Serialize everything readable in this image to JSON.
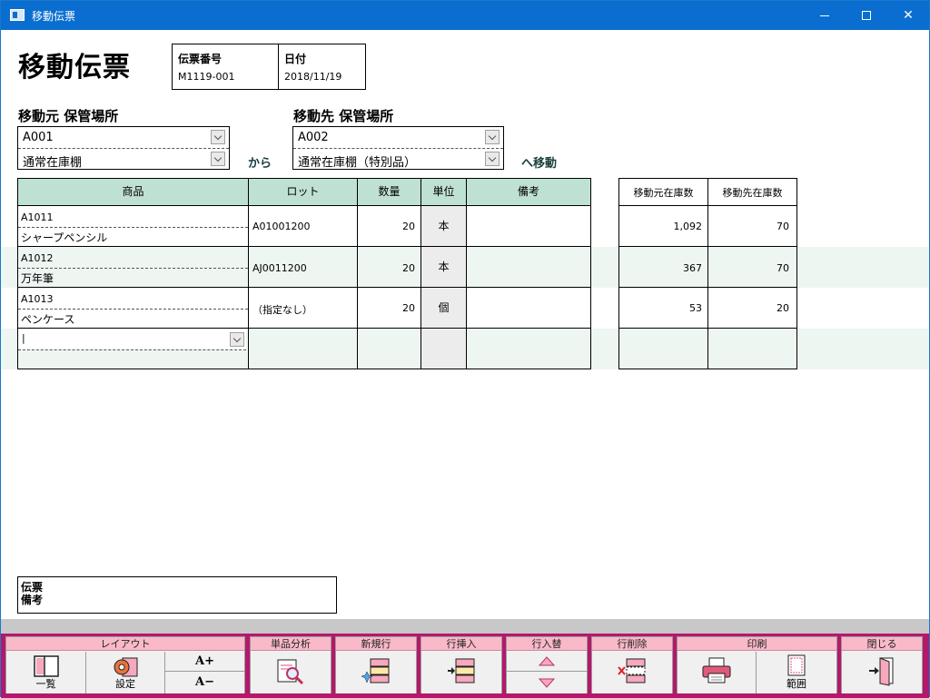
{
  "window": {
    "title": "移動伝票"
  },
  "page_title": "移動伝票",
  "header": {
    "slip_number_label": "伝票番号",
    "slip_number": "M1119-001",
    "date_label": "日付",
    "date": "2018/11/19"
  },
  "source": {
    "label": "移動元 保管場所",
    "location": "A001",
    "shelf": "通常在庫棚"
  },
  "source_connector": "から",
  "destination": {
    "label": "移動先 保管場所",
    "location": "A002",
    "shelf": "通常在庫棚（特別品）"
  },
  "destination_connector": "へ移動",
  "table": {
    "headers": {
      "product": "商品",
      "lot": "ロット",
      "qty": "数量",
      "unit": "単位",
      "note": "備考"
    },
    "rows": [
      {
        "code": "A1011",
        "name": "シャープペンシル",
        "lot": "A01001200",
        "qty": "20",
        "unit": "本",
        "note": ""
      },
      {
        "code": "A1012",
        "name": "万年筆",
        "lot": "AJ0011200",
        "qty": "20",
        "unit": "本",
        "note": ""
      },
      {
        "code": "A1013",
        "name": "ペンケース",
        "lot": "（指定なし）",
        "qty": "20",
        "unit": "個",
        "note": ""
      }
    ],
    "new_row_input": "|"
  },
  "stock_table": {
    "headers": {
      "source_stock": "移動元在庫数",
      "dest_stock": "移動先在庫数"
    },
    "rows": [
      {
        "source_stock": "1,092",
        "dest_stock": "70"
      },
      {
        "source_stock": "367",
        "dest_stock": "70"
      },
      {
        "source_stock": "53",
        "dest_stock": "20"
      }
    ]
  },
  "memo": {
    "label": "伝票備考"
  },
  "toolbar": {
    "layout": {
      "title": "レイアウト",
      "list": "一覧",
      "settings": "設定",
      "font_up": "A+",
      "font_down": "A−"
    },
    "analysis": {
      "title": "単品分析"
    },
    "new_row": {
      "title": "新規行"
    },
    "insert_row": {
      "title": "行挿入"
    },
    "swap_row": {
      "title": "行入替"
    },
    "delete_row": {
      "title": "行削除"
    },
    "print": {
      "title": "印刷",
      "range": "範囲"
    },
    "close": {
      "title": "閉じる"
    }
  }
}
